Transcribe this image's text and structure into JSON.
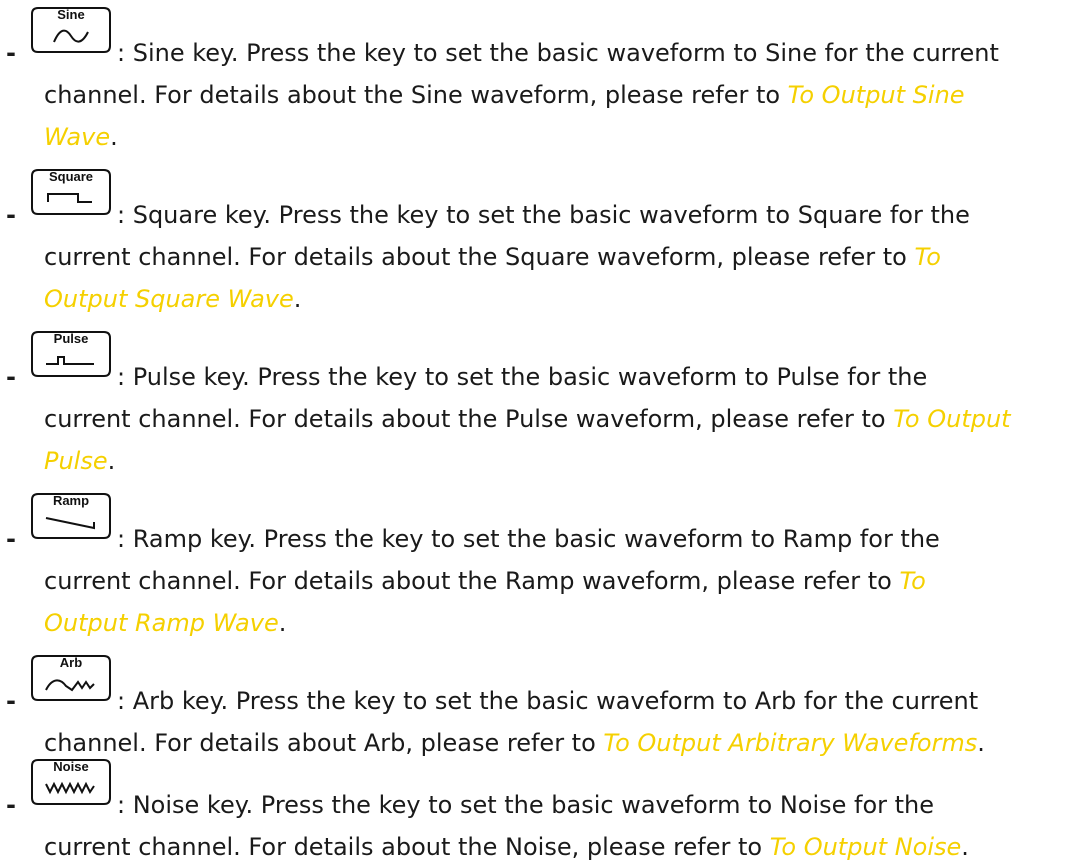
{
  "bullet": "-",
  "link_color": "#f5d000",
  "items": [
    {
      "key_label": "Sine",
      "icon": "sine-wave-icon",
      "line1": ": Sine key. Press the key to set the basic waveform to Sine for the current",
      "line2_text": "channel. For details about the Sine waveform, please refer to ",
      "line2_link": "To Output Sine",
      "line3_link": "Wave",
      "line3_text": "."
    },
    {
      "key_label": "Square",
      "icon": "square-wave-icon",
      "line1": ": Square key. Press the key to set the basic waveform to Square for the",
      "line2_text": "current channel. For details about the Square waveform, please refer to ",
      "line2_link": "To",
      "line3_link": "Output Square Wave",
      "line3_text": "."
    },
    {
      "key_label": "Pulse",
      "icon": "pulse-wave-icon",
      "line1": ": Pulse key. Press the key to set the basic waveform to Pulse for the",
      "line2_text": "current channel. For details about the Pulse waveform, please refer to ",
      "line2_link": "To Output",
      "line3_link": "Pulse",
      "line3_text": "."
    },
    {
      "key_label": "Ramp",
      "icon": "ramp-wave-icon",
      "line1": ": Ramp key. Press the key to set the basic waveform to Ramp for the",
      "line2_text": "current channel. For details about the Ramp waveform, please refer to ",
      "line2_link": "To",
      "line3_link": "Output Ramp Wave",
      "line3_text": "."
    },
    {
      "key_label": "Arb",
      "icon": "arb-wave-icon",
      "line1": ": Arb key. Press the key to set the basic waveform to Arb for the current",
      "line2_text": "channel. For details about Arb, please refer to ",
      "line2_link": "To Output Arbitrary Waveforms",
      "line2_after": "."
    },
    {
      "key_label": "Noise",
      "icon": "noise-wave-icon",
      "line1": ": Noise key. Press the key to set the basic waveform to Noise for the",
      "line2_text": "current channel. For details about the Noise, please refer to ",
      "line2_link": "To Output Noise",
      "line2_after": "."
    }
  ]
}
